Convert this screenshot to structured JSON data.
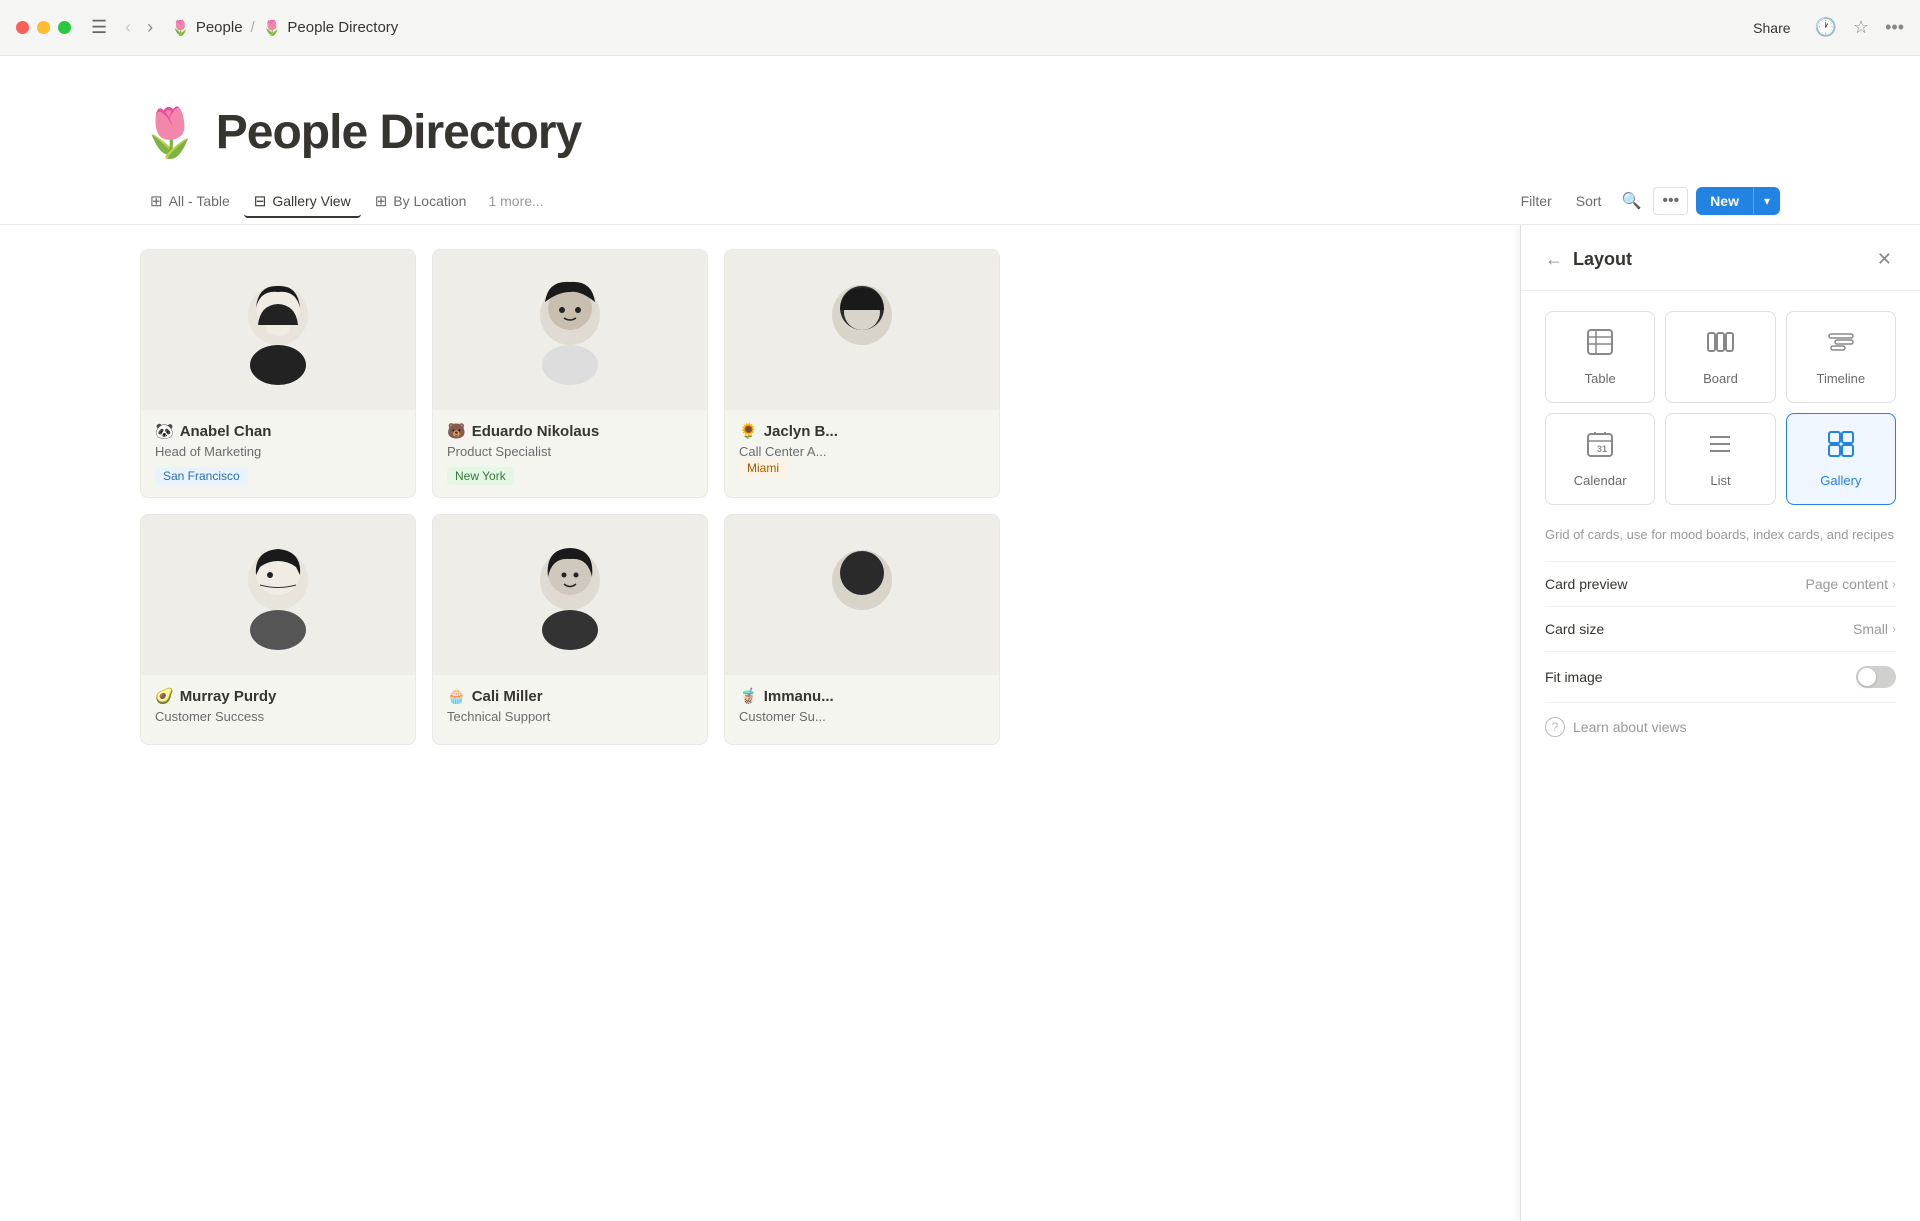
{
  "window": {
    "title": "People Directory"
  },
  "titlebar": {
    "breadcrumb_people": "People",
    "breadcrumb_sep": "/",
    "breadcrumb_page": "People Directory",
    "share_label": "Share",
    "people_emoji": "🌷",
    "page_emoji": "🌷"
  },
  "page": {
    "emoji": "🌷",
    "title": "People Directory"
  },
  "tabs": [
    {
      "id": "all-table",
      "icon": "⊞",
      "label": "All - Table",
      "active": false
    },
    {
      "id": "gallery-view",
      "icon": "⊟",
      "label": "Gallery View",
      "active": true
    },
    {
      "id": "by-location",
      "icon": "⊞",
      "label": "By Location",
      "active": false
    }
  ],
  "more_tabs": "1 more...",
  "toolbar": {
    "filter_label": "Filter",
    "sort_label": "Sort",
    "new_label": "New"
  },
  "gallery": {
    "cards": [
      {
        "id": 1,
        "emoji_prefix": "🐼",
        "name": "Anabel Chan",
        "role": "Head of Marketing",
        "location": "San Francisco",
        "tag_class": "tag-sf",
        "avatar": "🧏"
      },
      {
        "id": 2,
        "emoji_prefix": "🐻",
        "name": "Eduardo Nikolaus",
        "role": "Product Specialist",
        "location": "New York",
        "tag_class": "tag-ny",
        "avatar": "🧔"
      },
      {
        "id": 3,
        "emoji_prefix": "🌻",
        "name": "Jaclyn B...",
        "role": "Call Center A...",
        "location": "Miami",
        "tag_class": "tag-miami",
        "avatar": "👤",
        "partial": true
      },
      {
        "id": 4,
        "emoji_prefix": "🥑",
        "name": "Murray Purdy",
        "role": "Customer Success",
        "location": "",
        "tag_class": "",
        "avatar": "🧏‍♂️"
      },
      {
        "id": 5,
        "emoji_prefix": "🧁",
        "name": "Cali Miller",
        "role": "Technical Support",
        "location": "",
        "tag_class": "",
        "avatar": "👩"
      },
      {
        "id": 6,
        "emoji_prefix": "🧋",
        "name": "Immanu...",
        "role": "Customer Su...",
        "location": "",
        "tag_class": "",
        "avatar": "👤",
        "partial": true
      }
    ]
  },
  "layout_panel": {
    "title": "Layout",
    "options": [
      {
        "id": "table",
        "icon": "⊞",
        "label": "Table",
        "active": false
      },
      {
        "id": "board",
        "icon": "⧉",
        "label": "Board",
        "active": false
      },
      {
        "id": "timeline",
        "icon": "☰",
        "label": "Timeline",
        "active": false
      },
      {
        "id": "calendar",
        "icon": "📅",
        "label": "Calendar",
        "active": false
      },
      {
        "id": "list",
        "icon": "≡",
        "label": "List",
        "active": false
      },
      {
        "id": "gallery",
        "icon": "⊞",
        "label": "Gallery",
        "active": true
      }
    ],
    "description": "Grid of cards, use for mood boards, index cards, and recipes",
    "card_preview_label": "Card preview",
    "card_preview_value": "Page content",
    "card_size_label": "Card size",
    "card_size_value": "Small",
    "fit_image_label": "Fit image",
    "learn_label": "Learn about views"
  }
}
